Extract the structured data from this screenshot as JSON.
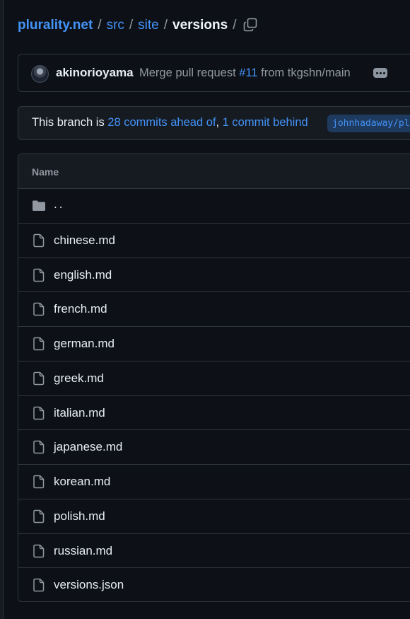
{
  "breadcrumb": {
    "repo": "plurality.net",
    "segments": [
      "src",
      "site"
    ],
    "current": "versions",
    "trailing_sep": "/",
    "sep": "/",
    "copy_icon": "copy-icon"
  },
  "commit": {
    "author": "akinorioyama",
    "message_prefix": "Merge pull request ",
    "pr_number": "#11",
    "message_suffix": " from tkgshn/main",
    "more_icon": "ellipsis-icon"
  },
  "branch_status": {
    "prefix": "This branch is ",
    "ahead": "28 commits ahead of",
    "comma": ", ",
    "behind": "1 commit behind",
    "upstream": "johnhadaway/plurality.net"
  },
  "table": {
    "header": "Name",
    "parent": "..",
    "files": [
      "chinese.md",
      "english.md",
      "french.md",
      "german.md",
      "greek.md",
      "italian.md",
      "japanese.md",
      "korean.md",
      "polish.md",
      "russian.md",
      "versions.json"
    ]
  },
  "colors": {
    "background": "#0d1117",
    "link": "#4493f8",
    "border": "#30363d",
    "muted": "#9198a1"
  }
}
